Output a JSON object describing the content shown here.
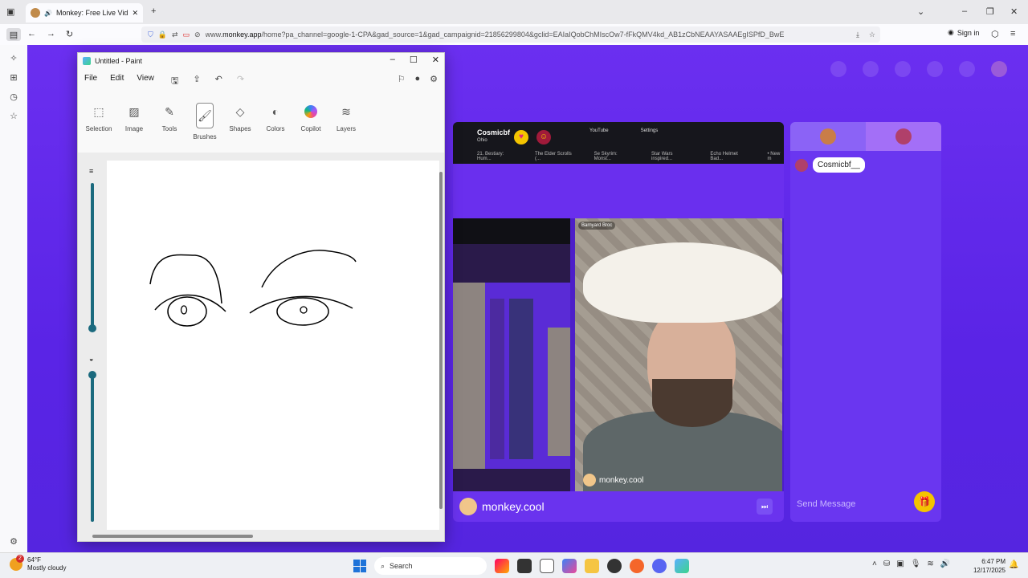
{
  "browser": {
    "tab_title": "Monkey: Free Live Video Ch",
    "new_tab_icon": "plus-icon",
    "url_prefix": "www.",
    "url_host": "monkey.app",
    "url_path": "/home?pa_channel=google-1-CPA&gad_source=1&gad_campaignid=21856299804&gclid=EAIaIQobChMIscOw7-fFkQMV4kd_AB1zCbNEAAYASAAEgISPfD_BwE",
    "signin_label": "Sign in"
  },
  "paint": {
    "title": "Untitled - Paint",
    "menu": [
      "File",
      "Edit",
      "View"
    ],
    "tools": [
      {
        "label": "Selection",
        "icon": "selection-icon"
      },
      {
        "label": "Image",
        "icon": "image-icon"
      },
      {
        "label": "Tools",
        "icon": "tools-icon"
      },
      {
        "label": "Brushes",
        "icon": "brush-icon"
      },
      {
        "label": "Shapes",
        "icon": "shapes-icon"
      },
      {
        "label": "Colors",
        "icon": "palette-icon"
      },
      {
        "label": "Copilot",
        "icon": "copilot-icon"
      },
      {
        "label": "Layers",
        "icon": "layers-icon"
      }
    ]
  },
  "monkey": {
    "top_user": "Cosmicbf",
    "top_user_location": "Ohio",
    "screen_tabs": [
      "YouTube",
      "Settings"
    ],
    "screen_bookmarks": [
      "21. Bestiary: Hum...",
      "The Elder Scrolls (...",
      "Se Skyrim: Monst...",
      "Star Wars inspired...",
      "Echo Helmet Bad...",
      "• New m"
    ],
    "main_user": "Barnyard Broc",
    "watermark": "monkey.cool",
    "watermark_bottom": "monkey.cool",
    "chat_user": "Cosmicbf__",
    "send_placeholder": "Send Message"
  },
  "taskbar": {
    "temp": "64°F",
    "weather": "Mostly cloudy",
    "weather_badge": "2",
    "search_label": "Search",
    "time": "6:47 PM",
    "date": "12/17/2025"
  },
  "colors": {
    "page_bg": "#6b2ff0",
    "accent_yellow": "#f4c400"
  }
}
